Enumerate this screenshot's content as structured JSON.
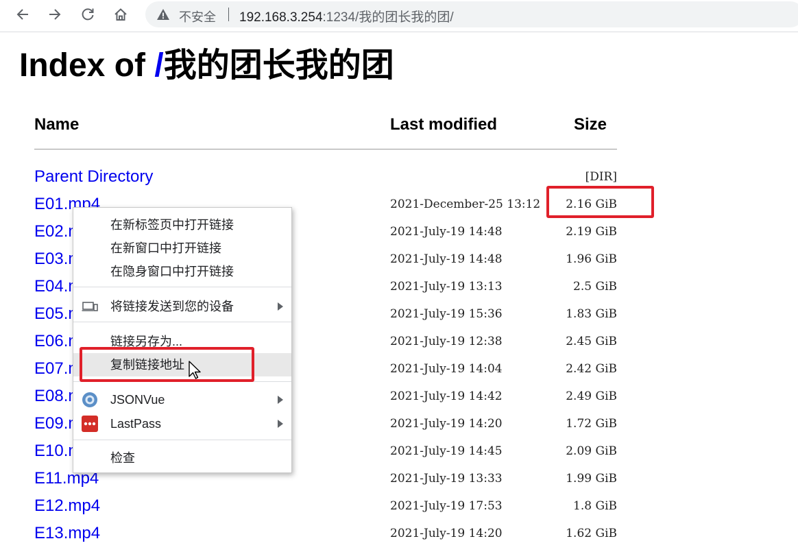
{
  "browser": {
    "insecure_label": "不安全",
    "url_host": "192.168.3.254",
    "url_path": ":1234/我的团长我的团/"
  },
  "page": {
    "title_prefix": "Index of ",
    "title_slash": "/",
    "title_dir": "我的团长我的团"
  },
  "table": {
    "headers": {
      "name": "Name",
      "modified": "Last modified",
      "size": "Size"
    },
    "parent": {
      "name": "Parent Directory",
      "size": "[DIR]"
    },
    "rows": [
      {
        "name": "E01.mp4",
        "date": "2021-December-25 13:12",
        "size": "2.16 GiB"
      },
      {
        "name": "E02.mp4",
        "date": "2021-July-19 14:48",
        "size": "2.19 GiB"
      },
      {
        "name": "E03.mp4",
        "date": "2021-July-19 14:48",
        "size": "1.96 GiB"
      },
      {
        "name": "E04.mp4",
        "date": "2021-July-19 13:13",
        "size": "2.5 GiB"
      },
      {
        "name": "E05.mp4",
        "date": "2021-July-19 15:36",
        "size": "1.83 GiB"
      },
      {
        "name": "E06.mp4",
        "date": "2021-July-19 12:38",
        "size": "2.45 GiB"
      },
      {
        "name": "E07.mp4",
        "date": "2021-July-19 14:04",
        "size": "2.42 GiB"
      },
      {
        "name": "E08.mp4",
        "date": "2021-July-19 14:42",
        "size": "2.49 GiB"
      },
      {
        "name": "E09.mp4",
        "date": "2021-July-19 14:20",
        "size": "1.72 GiB"
      },
      {
        "name": "E10.mp4",
        "date": "2021-July-19 14:45",
        "size": "2.09 GiB"
      },
      {
        "name": "E11.mp4",
        "date": "2021-July-19 13:33",
        "size": "1.99 GiB"
      },
      {
        "name": "E12.mp4",
        "date": "2021-July-19 17:53",
        "size": "1.8 GiB"
      },
      {
        "name": "E13.mp4",
        "date": "2021-July-19 14:20",
        "size": "1.62 GiB"
      }
    ]
  },
  "context_menu": {
    "open_new_tab": "在新标签页中打开链接",
    "open_new_window": "在新窗口中打开链接",
    "open_incognito": "在隐身窗口中打开链接",
    "send_to_devices": "将链接发送到您的设备",
    "save_link_as": "链接另存为...",
    "copy_link_address": "复制链接地址",
    "jsonvue": "JSONVue",
    "lastpass": "LastPass",
    "inspect": "检查"
  },
  "colors": {
    "link": "#0000ee",
    "highlight_box": "#e0202a",
    "lastpass_brand": "#d32d27",
    "jsonvue_brand": "#5b8fc7"
  }
}
